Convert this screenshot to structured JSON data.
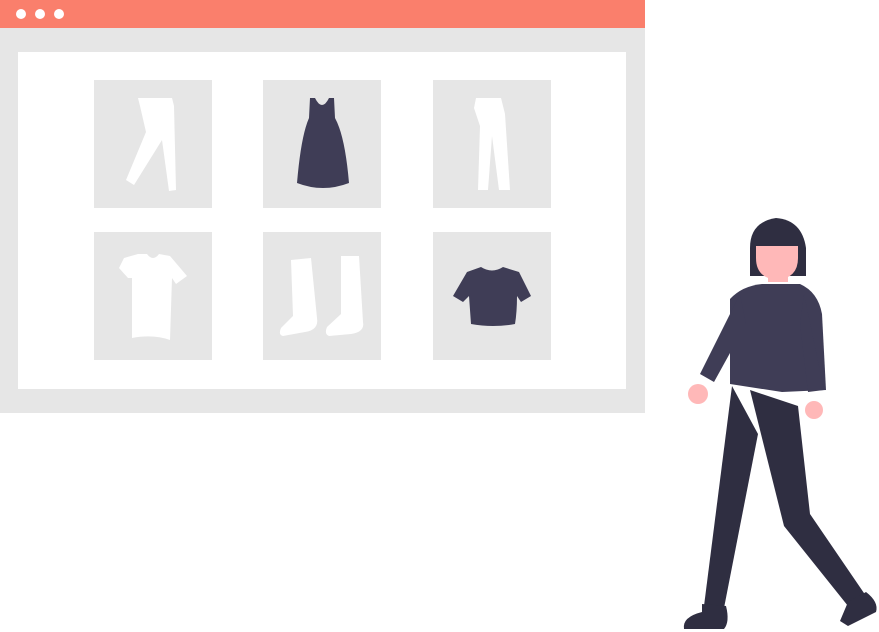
{
  "colors": {
    "titlebar": "#fa7f6c",
    "frame": "#e6e6e6",
    "content": "#ffffff",
    "white_item": "#ffffff",
    "dark_item": "#3f3d56",
    "hair": "#2f2e41",
    "skin": "#ffb8b8"
  },
  "products": [
    {
      "icon": "pants-icon",
      "tone": "white"
    },
    {
      "icon": "dress-icon",
      "tone": "dark"
    },
    {
      "icon": "trousers-icon",
      "tone": "white"
    },
    {
      "icon": "tshirt-icon",
      "tone": "white"
    },
    {
      "icon": "boots-icon",
      "tone": "white"
    },
    {
      "icon": "crop-top-icon",
      "tone": "dark"
    }
  ]
}
